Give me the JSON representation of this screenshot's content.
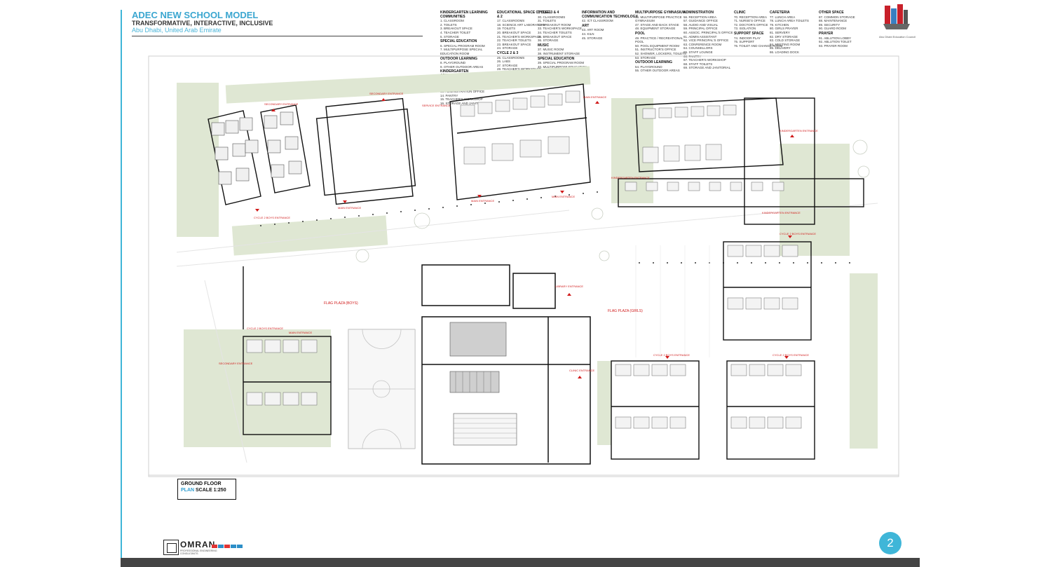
{
  "header": {
    "title": "ADEC NEW SCHOOL MODEL",
    "subtitle": "TRANSFORMATIVE, INTERACTIVE, INCLUSIVE",
    "location": "Abu Dhabi, United Arab Emirate"
  },
  "legend": [
    {
      "heading": "KINDERGARTEN LEARNING COMMUNITIES",
      "items": [
        "1. CLASSROOM",
        "2. TOILETS",
        "3. BREAKOUT SPACE",
        "4. TEACHER TOILET",
        "5. STORAGE"
      ]
    },
    {
      "heading": "SPECIAL EDUCATION",
      "items": [
        "6. SPECIAL PROGRAM ROOM",
        "7. MULTIPURPOSE SPECIAL EDUCATION ROOM"
      ]
    },
    {
      "heading": "OUTDOOR LEARNING",
      "items": [
        "8. PLAYGROUND",
        "9. OTHER OUTDOOR AREAS"
      ]
    },
    {
      "heading": "KINDERGARTEN ADMINISTRATION",
      "items": [
        "10. RECEPTION AREA",
        "11. VICE PRINCIPAL OFFICE",
        "12. INSTRUCTION OFFICE",
        "13. ADMINISTRATION OFFICE",
        "14. PANTRY",
        "15. TEACHER'S WORKSHOP",
        "16. STORAGE AND JANITORIAL"
      ]
    },
    {
      "heading": "EDUCATIONAL SPACE CYCLE 1 & 2",
      "items": [
        "17. CLASSROOMS",
        "18. SCIENCE ART LABORATORY",
        "19. TOILETS",
        "20. BREAKOUT SPACE",
        "21. TEACHER'S WORKSPACE",
        "22. TEACHER TOILETS",
        "23. BREAKOUT SPACE",
        "24. STORAGE"
      ]
    },
    {
      "heading": "CYCLE 2 & 3",
      "items": [
        "25. CLASSROOMS",
        "26. LABS",
        "27. STORAGE",
        "28. TEACHER'S WORKSPACE",
        "29. BREAKOUT SPACE"
      ]
    },
    {
      "heading": "CYCLE 3 & 4",
      "items": [
        "30. CLASSROOMS",
        "31. TOILETS",
        "32. BREAKOUT ROOM",
        "33. TEACHER'S WORKSPACE",
        "34. TEACHER TOILETS",
        "35. BREAKOUT SPACE",
        "36. STORAGE"
      ]
    },
    {
      "heading": "MUSIC",
      "items": [
        "37. MUSIC ROOM",
        "38. INSTRUMENT STORAGE"
      ]
    },
    {
      "heading": "SPECIAL EDUCATION",
      "items": [
        "39. SPECIAL PROGRAM ROOM",
        "40. MULTIPURPOSE EDUCATION ROOM",
        "41. TOILETS/CHANGING"
      ]
    },
    {
      "heading": "INFORMATION AND COMMUNICATION TECHNOLOGY",
      "items": [
        "42. ICT CLASSROOM"
      ]
    },
    {
      "heading": "ART",
      "items": [
        "43. ART ROOM",
        "44. KILN",
        "45. STORAGE"
      ]
    },
    {
      "heading": "MULTIPURPOSE GYMNASIUM",
      "items": [
        "46. MULTIPURPOSE PRACTICE GYMNASIUM",
        "47. STAGE AND BACK STAGE",
        "48. EQUIPMENT STORAGE"
      ]
    },
    {
      "heading": "POOL",
      "items": [
        "49. PRACTICE / RECREATIONAL POOL",
        "50. POOL EQUIPMENT ROOM",
        "51. INSTRUCTOR'S OFFICE",
        "52. SHOWER, LOCKERS, TOILETS",
        "53. STORAGE"
      ]
    },
    {
      "heading": "OUTDOOR LEARNING",
      "items": [
        "54. PLAYGROUND",
        "55. OTHER OUTDOOR AREAS"
      ]
    },
    {
      "heading": "ADMINISTRATION",
      "items": [
        "56. RECEPTION AREA",
        "57. GUIDANCE OFFICE",
        "58. AUDIO AND VISUAL",
        "59. PRINCIPAL OFFICE",
        "60. ASSOC. PRINCIPAL'S OFFICE",
        "61. ADMIN ASSISTANT",
        "62. VICE PRINCIPAL'S OFFICE",
        "63. CONFERENCE ROOM",
        "64. COUNSELLORS",
        "65. STAFF LOUNGE",
        "66. PANTRY",
        "67. TEACHER'S WORKSHOP",
        "68. STAFF TOILETS",
        "69. STORAGE AND JANITORIAL"
      ]
    },
    {
      "heading": "CLINIC",
      "items": [
        "70. RECEPTION AREA",
        "71. NURSE'S OFFICE",
        "72. DOCTOR'S OFFICE",
        "73. ISOLATION"
      ]
    },
    {
      "heading": "SUPPORT SPACE",
      "items": [
        "74. INDOOR PLAY",
        "75. SUPPORT",
        "76. TOILET AND CHANGE ROOM"
      ]
    },
    {
      "heading": "CAFETERIA",
      "items": [
        "77. LUNCH AREA",
        "78. LUNCH AREA TOILETS",
        "79. KITCHEN",
        "80. GIRLS PRAYER",
        "81. SERVERY",
        "82. DRY STORAGE",
        "83. COLD STORAGE",
        "84. MEETING ROOM",
        "85. DELIVERY",
        "86. LOADING DOCK"
      ]
    },
    {
      "heading": "OTHER SPACE",
      "items": [
        "87. COMMON STORAGE",
        "88. MAINTENANCE",
        "89. SECURITY",
        "90. GUARD ROOM"
      ]
    },
    {
      "heading": "PRAYER",
      "items": [
        "91. ABLUTION LOBBY",
        "92. ABLUTION TOILET",
        "93. PRAYER ROOM"
      ]
    }
  ],
  "logo": {
    "caption": "Abu Dhabi Education Council"
  },
  "plan_labels": {
    "flag_plaza_boys": "FLAG PLAZA (BOYS)",
    "flag_plaza_girls": "FLAG PLAZA (GIRLS)",
    "secondary_entrance": "SECONDARY ENTRANCE",
    "main_entrance": "MAIN ENTRANCE",
    "service_entrance": "SERVICE ENTRANCE",
    "kindergarten_entrance": "KINDERGARTEN ENTRANCE",
    "library_entrance": "LIBRARY ENTRANCE",
    "clinic_entrance": "CLINIC ENTRANCE",
    "cycle_entrance": "CYCLE 2 BOYS ENTRANCE"
  },
  "plan_title": {
    "line1": "GROUND FLOOR",
    "plan": "PLAN",
    "scale": "SCALE 1:250"
  },
  "footer": {
    "company": "OMRAN",
    "tagline": "PROFESSIONAL ENGINEERING CONSULTANTS",
    "page_number": "2",
    "swatch_colors": [
      "#e03434",
      "#2d8fc8",
      "#e03434",
      "#2d8fc8",
      "#2d8fc8"
    ]
  },
  "colors": {
    "accent": "#3fb6d8",
    "landscape": "#dfe7d3",
    "walls": "#111111",
    "entrance": "#d01a1a"
  }
}
